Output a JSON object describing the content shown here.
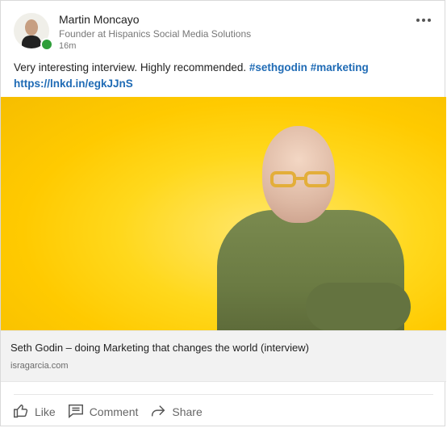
{
  "post": {
    "author": {
      "name": "Martin Moncayo",
      "headline": "Founder at Hispanics Social Media Solutions",
      "time": "16m",
      "status_color": "#2f9e3a"
    },
    "text": {
      "main": "Very interesting interview. Highly recommended.",
      "hashtags": [
        "#sethgodin",
        "#marketing"
      ],
      "short_link": "https://lnkd.in/egkJJnS"
    },
    "preview": {
      "title": "Seth Godin – doing Marketing that changes the world (interview)",
      "domain": "isragarcia.com",
      "background_color": "#ffc800"
    },
    "actions": {
      "like": "Like",
      "comment": "Comment",
      "share": "Share"
    },
    "icons": {
      "more": "more-icon",
      "like": "thumbs-up-icon",
      "comment": "comment-icon",
      "share": "share-icon"
    }
  }
}
